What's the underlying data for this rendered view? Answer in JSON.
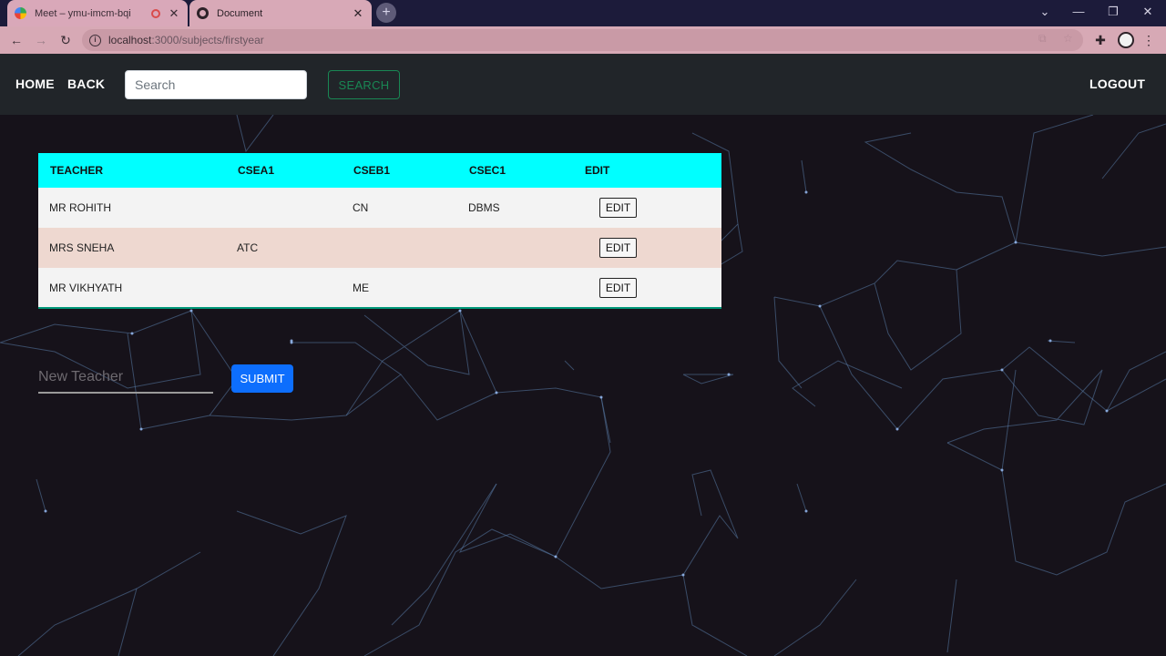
{
  "browser": {
    "tabs": [
      {
        "title": "Meet – ymu-imcm-bqi",
        "favicon": "google-meet-icon",
        "recording": true
      },
      {
        "title": "Document",
        "favicon": "globe-icon"
      }
    ],
    "url_host": "localhost",
    "url_rest": ":3000/subjects/firstyear"
  },
  "navbar": {
    "home": "HOME",
    "back": "BACK",
    "search_placeholder": "Search",
    "search_button": "SEARCH",
    "logout": "LOGOUT"
  },
  "table": {
    "headers": [
      "TEACHER",
      "CSEA1",
      "CSEB1",
      "CSEC1",
      "EDIT"
    ],
    "rows": [
      {
        "teacher": "MR ROHITH",
        "csea1": "",
        "cseb1": "CN",
        "csec1": "DBMS",
        "edit": "EDIT"
      },
      {
        "teacher": "MRS SNEHA",
        "csea1": "ATC",
        "cseb1": "",
        "csec1": "",
        "edit": "EDIT"
      },
      {
        "teacher": "MR VIKHYATH",
        "csea1": "",
        "cseb1": "ME",
        "csec1": "",
        "edit": "EDIT"
      }
    ]
  },
  "form": {
    "new_teacher_placeholder": "New Teacher",
    "submit": "SUBMIT"
  },
  "colors": {
    "table_header": "#00ffff",
    "row_odd": "#f3f3f3",
    "row_even": "#eed8d0",
    "submit": "#0d6efd",
    "search_outline": "#198754",
    "navbar": "#212529"
  }
}
